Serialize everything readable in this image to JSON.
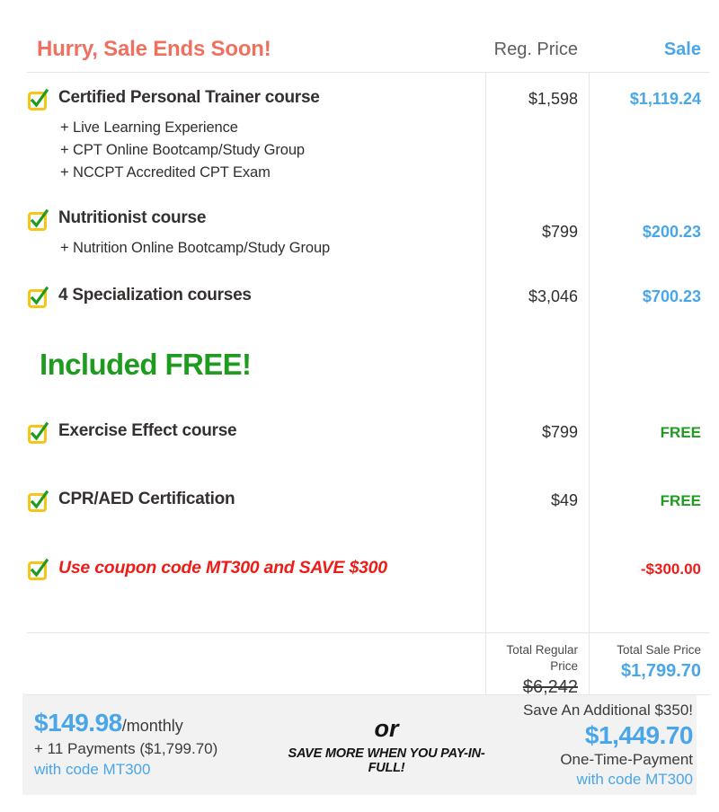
{
  "colors": {
    "accent_blue": "#49a6e9",
    "promo_red": "#f0705f",
    "coupon_red": "#ee1c17",
    "free_green": "#1f9c1f",
    "checkbox_yellow": "#f5c518",
    "check_green": "#1f9c1f",
    "footer_bg": "#f2f2f2"
  },
  "header": {
    "headline": "Hurry, Sale Ends Soon!",
    "reg_price_label": "Reg. Price",
    "sale_label": "Sale"
  },
  "items": [
    {
      "title": "Certified Personal Trainer course",
      "reg_price": "$1,598",
      "sale_price": "$1,119.24",
      "sub_items": [
        "+ Live Learning Experience",
        "+ CPT Online Bootcamp/Study Group",
        "+ NCCPT Accredited CPT Exam"
      ]
    },
    {
      "title": "Nutritionist course",
      "reg_price": "$799",
      "sale_price": "$200.23",
      "sub_items": [
        "+ Nutrition Online Bootcamp/Study Group"
      ]
    },
    {
      "title": "4 Specialization courses",
      "reg_price": "$3,046",
      "sale_price": "$700.23",
      "sub_items": []
    }
  ],
  "free_banner": "Included FREE!",
  "free_items": [
    {
      "title": "Exercise Effect course",
      "reg_price": "$799",
      "sale_price": "FREE"
    },
    {
      "title": "CPR/AED Certification",
      "reg_price": "$49",
      "sale_price": "FREE"
    }
  ],
  "coupon_row": {
    "title": "Use coupon code MT300 and SAVE $300",
    "reg_price": "",
    "sale_price": "-$300.00"
  },
  "totals": {
    "regular_label": "Total Regular Price",
    "regular_value": "$6,242",
    "sale_label": "Total Sale Price",
    "sale_value": "$1,799.70"
  },
  "footer": {
    "monthly_amount": "$149.98",
    "monthly_period": "/monthly",
    "installments": "+ 11 Payments ($1,799.70)",
    "monthly_code": "with code MT300",
    "or_word": "or",
    "or_subtext": "SAVE MORE WHEN YOU PAY-IN-FULL!",
    "additional_savings": "Save An Additional $350!",
    "payinfull_amount": "$1,449.70",
    "payinfull_label": "One-Time-Payment",
    "payinfull_code": "with code MT300"
  }
}
